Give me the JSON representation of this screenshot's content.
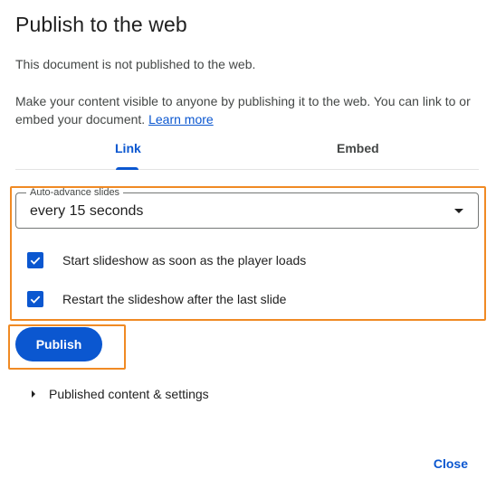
{
  "dialog": {
    "title": "Publish to the web",
    "status": "This document is not published to the web.",
    "description": "Make your content visible to anyone by publishing it to the web. You can link to or embed your document.",
    "learn_more": "Learn more"
  },
  "tabs": [
    {
      "label": "Link",
      "selected": true
    },
    {
      "label": "Embed",
      "selected": false
    }
  ],
  "auto_advance": {
    "label": "Auto-advance slides",
    "value": "every 15 seconds",
    "icon": "dropdown-arrow-icon"
  },
  "options": [
    {
      "label": "Start slideshow as soon as the player loads",
      "checked": true
    },
    {
      "label": "Restart the slideshow after the last slide",
      "checked": true
    }
  ],
  "publish_button": "Publish",
  "published_settings": "Published content & settings",
  "close_button": "Close",
  "colors": {
    "accent": "#0b57d0",
    "highlight": "#f08a24"
  }
}
